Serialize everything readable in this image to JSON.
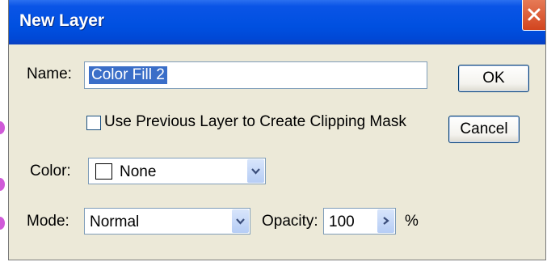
{
  "dialog": {
    "title": "New Layer",
    "name_label": "Name:",
    "name_value": "Color Fill 2",
    "ok_label": "OK",
    "cancel_label": "Cancel",
    "clipping_label": "Use Previous Layer to Create Clipping Mask",
    "clipping_checked": false,
    "color_label": "Color:",
    "color_value": "None",
    "mode_label": "Mode:",
    "mode_value": "Normal",
    "opacity_label": "Opacity:",
    "opacity_value": "100",
    "opacity_unit": "%"
  },
  "colors": {
    "titlebar": "#0050e0",
    "dialog_bg": "#ece9d8",
    "selection": "#3a6ec8",
    "close_button": "#d2451f"
  },
  "icons": [
    "close-icon",
    "chevron-down-icon",
    "chevron-right-icon"
  ]
}
